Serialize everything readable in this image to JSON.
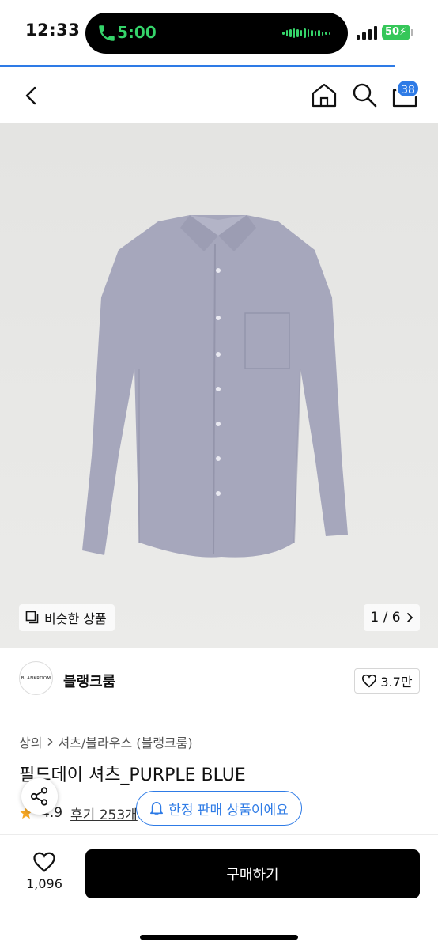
{
  "status_bar": {
    "time": "12:33",
    "call_time": "5:00",
    "battery": "50"
  },
  "header": {
    "cart_count": "38"
  },
  "gallery": {
    "similar_label": "비슷한 상품",
    "page_indicator": "1 / 6"
  },
  "brand": {
    "logo_text": "BLANKROOM",
    "name": "블랭크룸",
    "likes": "3.7만"
  },
  "breadcrumb": {
    "items": [
      "상의",
      "셔츠/블라우스 (블랭크룸)"
    ]
  },
  "product": {
    "title": "필드데이 셔츠_PURPLE BLUE",
    "rating": "4.9",
    "review_link": "후기 253개"
  },
  "notice": {
    "limited_label": "한정 판매 상품이에요"
  },
  "bottom": {
    "wish_count": "1,096",
    "buy_label": "구매하기"
  },
  "colors": {
    "accent": "#2e7be6",
    "call_green": "#35d46a",
    "shirt": "#a6a7bc"
  },
  "icons": [
    "phone-icon",
    "back-icon",
    "home-icon",
    "search-icon",
    "cart-icon",
    "similar-icon",
    "chevron-right-icon",
    "heart-icon",
    "star-icon",
    "bell-icon",
    "share-icon"
  ]
}
